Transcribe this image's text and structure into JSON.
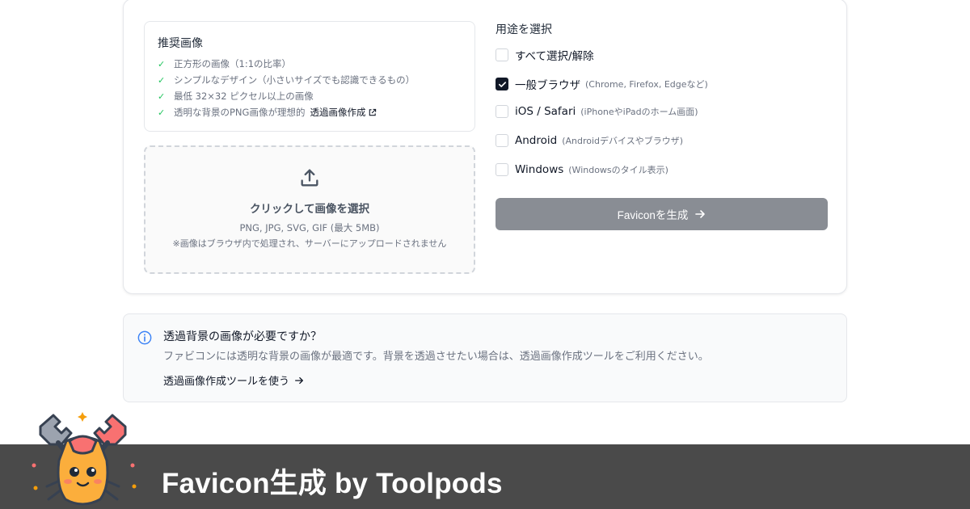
{
  "recommended": {
    "title": "推奨画像",
    "items": [
      {
        "text": "正方形の画像（1:1の比率）"
      },
      {
        "text": "シンプルなデザイン（小さいサイズでも認識できるもの）"
      },
      {
        "text": "最低 32×32 ピクセル以上の画像"
      },
      {
        "text": "透明な背景のPNG画像が理想的",
        "link": "透過画像作成"
      }
    ],
    "check_icon": "check-icon",
    "link_icon": "external-link-icon"
  },
  "upload": {
    "icon": "upload-icon",
    "title": "クリックして画像を選択",
    "formats": "PNG, JPG, SVG, GIF (最大 5MB)",
    "note": "※画像はブラウザ内で処理され、サーバーにアップロードされません"
  },
  "purpose": {
    "title": "用途を選択",
    "options": [
      {
        "label": "すべて選択/解除",
        "desc": "",
        "checked": false
      },
      {
        "label": "一般ブラウザ",
        "desc": "(Chrome, Firefox, Edgeなど)",
        "checked": true
      },
      {
        "label": "iOS / Safari",
        "desc": "(iPhoneやiPadのホーム画面)",
        "checked": false
      },
      {
        "label": "Android",
        "desc": "(Androidデバイスやブラウザ)",
        "checked": false
      },
      {
        "label": "Windows",
        "desc": "(Windowsのタイル表示)",
        "checked": false
      }
    ],
    "button_label": "Faviconを生成",
    "button_icon": "arrow-right-icon"
  },
  "info": {
    "icon": "info-icon",
    "title": "透過背景の画像が必要ですか？",
    "text": "ファビコンには透明な背景の画像が最適です。背景を透過させたい場合は、透過画像作成ツールをご利用ください。",
    "link_label": "透過画像作成ツールを使う",
    "link_icon": "arrow-right-icon"
  },
  "footer": {
    "title": "Favicon生成 by Toolpods",
    "mascot": "crab-mascot-logo"
  },
  "colors": {
    "button_disabled": "#898d94",
    "check_green": "#22c55e",
    "checkbox_checked": "#111827",
    "footer_band": "#4a4a4a",
    "info_blue": "#3b82f6"
  }
}
